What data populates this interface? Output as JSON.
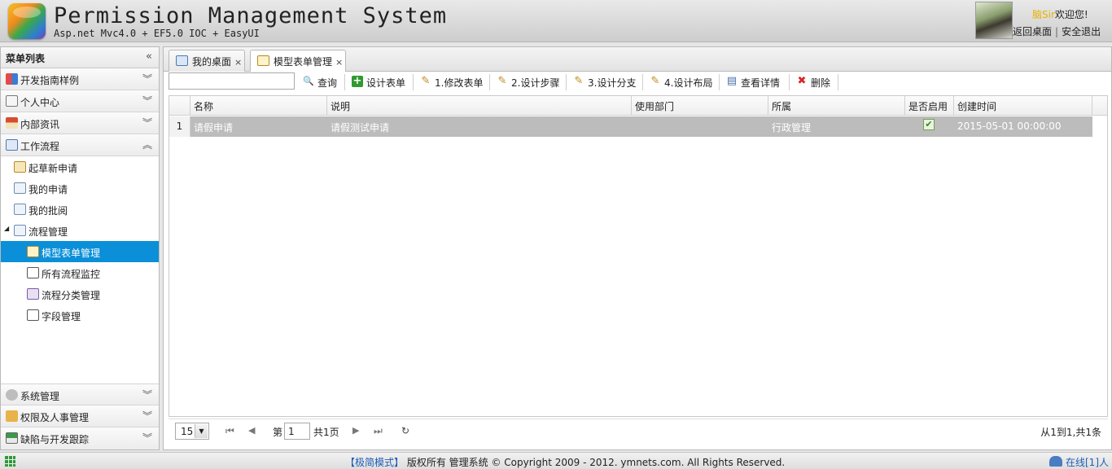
{
  "header": {
    "title": "Permission Management System",
    "subtitle": "Asp.net Mvc4.0 + EF5.0 IOC + EasyUI",
    "username": "脑Sir",
    "welcome": "欢迎您!",
    "back_desktop": "返回桌面",
    "separator": "|",
    "logout": "安全退出"
  },
  "sidebar": {
    "title": "菜单列表",
    "collapse_glyph": "«",
    "top_sections": [
      {
        "label": "开发指南样例",
        "icon": "grid-icon"
      },
      {
        "label": "个人中心",
        "icon": "book-icon"
      },
      {
        "label": "内部资讯",
        "icon": "house-icon"
      },
      {
        "label": "工作流程",
        "icon": "workflow-icon"
      }
    ],
    "tree": [
      {
        "label": "起草新申请",
        "icon": "form-icon"
      },
      {
        "label": "我的申请",
        "icon": "doc-icon"
      },
      {
        "label": "我的批阅",
        "icon": "review-icon"
      },
      {
        "label": "流程管理",
        "icon": "flow-icon",
        "toggle": "◢"
      },
      {
        "label": "模型表单管理",
        "icon": "calendar-icon"
      },
      {
        "label": "所有流程监控",
        "icon": "list-icon"
      },
      {
        "label": "流程分类管理",
        "icon": "category-icon"
      },
      {
        "label": "字段管理",
        "icon": "field-icon"
      }
    ],
    "bottom_sections": [
      {
        "label": "系统管理",
        "icon": "gear-icon"
      },
      {
        "label": "权限及人事管理",
        "icon": "key-icon"
      },
      {
        "label": "缺陷与开发跟踪",
        "icon": "bug-track-icon"
      }
    ],
    "chevron_down": "︾",
    "chevron_up": "︽"
  },
  "tabs": [
    {
      "label": "我的桌面",
      "close": "×"
    },
    {
      "label": "模型表单管理",
      "close": "×"
    }
  ],
  "toolbar": {
    "search_value": "",
    "buttons": [
      {
        "label": "查询",
        "icon": "search-icon",
        "glyph": "🔍"
      },
      {
        "label": "设计表单",
        "icon": "plus-icon",
        "glyph": "+"
      },
      {
        "label": "1.修改表单",
        "icon": "pencil-icon",
        "glyph": "✎"
      },
      {
        "label": "2.设计步骤",
        "icon": "pencil-icon",
        "glyph": "✎"
      },
      {
        "label": "3.设计分支",
        "icon": "pencil-icon",
        "glyph": "✎"
      },
      {
        "label": "4.设计布局",
        "icon": "pencil-icon",
        "glyph": "✎"
      },
      {
        "label": "查看详情",
        "icon": "details-icon",
        "glyph": "▤"
      },
      {
        "label": "删除",
        "icon": "delete-icon",
        "glyph": "✖"
      }
    ]
  },
  "grid": {
    "columns": [
      "名称",
      "说明",
      "使用部门",
      "所属",
      "是否启用",
      "创建时间"
    ],
    "rows": [
      {
        "num": "1",
        "name": "请假申请",
        "desc": "请假测试申请",
        "dept": "",
        "belong": "行政管理",
        "enabled": "✔",
        "created": "2015-05-01 00:00:00"
      }
    ]
  },
  "pager": {
    "page_size": "15",
    "page_prefix": "第",
    "page": "1",
    "page_suffix": "共1页",
    "info": "从1到1,共1条",
    "first": "⏮",
    "prev": "◀",
    "next": "▶",
    "last": "⏭",
    "refresh": "↻"
  },
  "footer": {
    "mode": "【极简模式】",
    "copyright": "版权所有 管理系统 © Copyright 2009 - 2012. ymnets.com. All Rights Reserved.",
    "online": "在线[1]人"
  },
  "colors": {
    "selected_bg": "#0a8fd8",
    "row_bg": "#bcbcbc",
    "welcome_user": "#e8b200",
    "link_blue": "#1f5db6"
  }
}
